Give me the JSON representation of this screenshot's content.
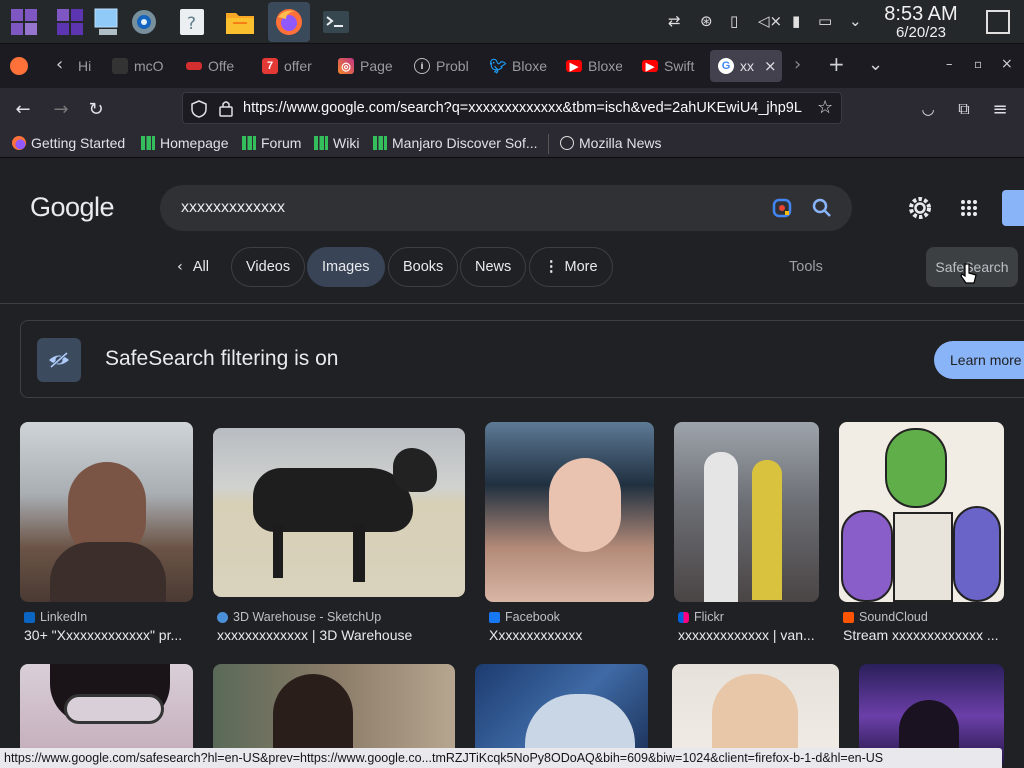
{
  "taskbar": {
    "apps": [
      "app-launcher-icon",
      "workspace-icon",
      "window-icon",
      "settings-icon",
      "help-icon",
      "files-icon",
      "firefox-icon",
      "terminal-icon"
    ],
    "clock_time": "8:53 AM",
    "clock_date": "6/20/23"
  },
  "tabs": [
    {
      "label": "Hi",
      "color": "#555"
    },
    {
      "label": "mcO",
      "color": "#444"
    },
    {
      "label": "Offe",
      "color": "#d32f2f"
    },
    {
      "label": "offer",
      "color": "#e53935"
    },
    {
      "label": "Page",
      "color": "#c13584"
    },
    {
      "label": "Probl",
      "color": "#888"
    },
    {
      "label": "Bloxe",
      "color": "#1d9bf0"
    },
    {
      "label": "Bloxe",
      "color": "#ff0000"
    },
    {
      "label": "Swift",
      "color": "#ff0000"
    },
    {
      "label": "xx",
      "color": "#4285f4"
    }
  ],
  "nav": {
    "url": "https://www.google.com/search?q=xxxxxxxxxxxxx&tbm=isch&ved=2ahUKEwiU4_jhp9L"
  },
  "bookmarks": [
    {
      "label": "Getting Started",
      "icon": "firefox-icon"
    },
    {
      "label": "Homepage",
      "icon": "manjaro-icon"
    },
    {
      "label": "Forum",
      "icon": "manjaro-icon"
    },
    {
      "label": "Wiki",
      "icon": "manjaro-icon"
    },
    {
      "label": "Manjaro Discover Sof...",
      "icon": "manjaro-icon"
    },
    {
      "label": "Mozilla News",
      "icon": "globe-icon"
    }
  ],
  "google": {
    "logo": "Google",
    "query": "xxxxxxxxxxxxx",
    "chips": {
      "all": "All",
      "videos": "Videos",
      "images": "Images",
      "books": "Books",
      "news": "News",
      "more": "More"
    },
    "tools": "Tools",
    "safesearch": "SafeSearch",
    "banner_text": "SafeSearch filtering is on",
    "learn_more": "Learn more"
  },
  "results": [
    {
      "source": "LinkedIn",
      "title": "30+ \"Xxxxxxxxxxxxx\" pr...",
      "source_color": "#0a66c2"
    },
    {
      "source": "3D Warehouse - SketchUp",
      "title": "xxxxxxxxxxxxx | 3D Warehouse",
      "source_color": "#4a90d9"
    },
    {
      "source": "Facebook",
      "title": "Xxxxxxxxxxxxx",
      "source_color": "#1877f2"
    },
    {
      "source": "Flickr",
      "title": "xxxxxxxxxxxxx | van...",
      "source_color": "#ff0084"
    },
    {
      "source": "SoundCloud",
      "title": "Stream xxxxxxxxxxxxx ...",
      "source_color": "#ff5500"
    }
  ],
  "status_url": "https://www.google.com/safesearch?hl=en-US&prev=https://www.google.co...tmRZJTiKcqk5NoPy8ODoAQ&bih=609&biw=1024&client=firefox-b-1-d&hl=en-US"
}
